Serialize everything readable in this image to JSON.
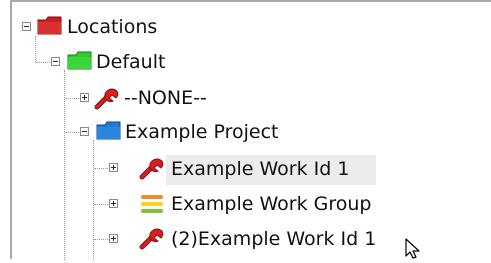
{
  "tree": {
    "nodes": [
      {
        "label": "Locations",
        "icon": "red-folder-icon"
      },
      {
        "label": "Default",
        "icon": "green-folder-icon"
      },
      {
        "label": "--NONE--",
        "icon": "red-wrench-icon"
      },
      {
        "label": "Example Project",
        "icon": "blue-folder-icon"
      },
      {
        "label": "Example Work Id 1",
        "icon": "red-wrench-icon"
      },
      {
        "label": "Example Work Group",
        "icon": "stacked-bars-icon"
      },
      {
        "label": "(2)Example Work Id 1",
        "icon": "red-wrench-icon"
      }
    ]
  },
  "colors": {
    "folder_red": "#cc1f1f",
    "folder_green": "#2ecc2e",
    "folder_blue": "#1f7ad6",
    "wrench_red": "#d81e1e",
    "selection_bg": "#ececec"
  }
}
